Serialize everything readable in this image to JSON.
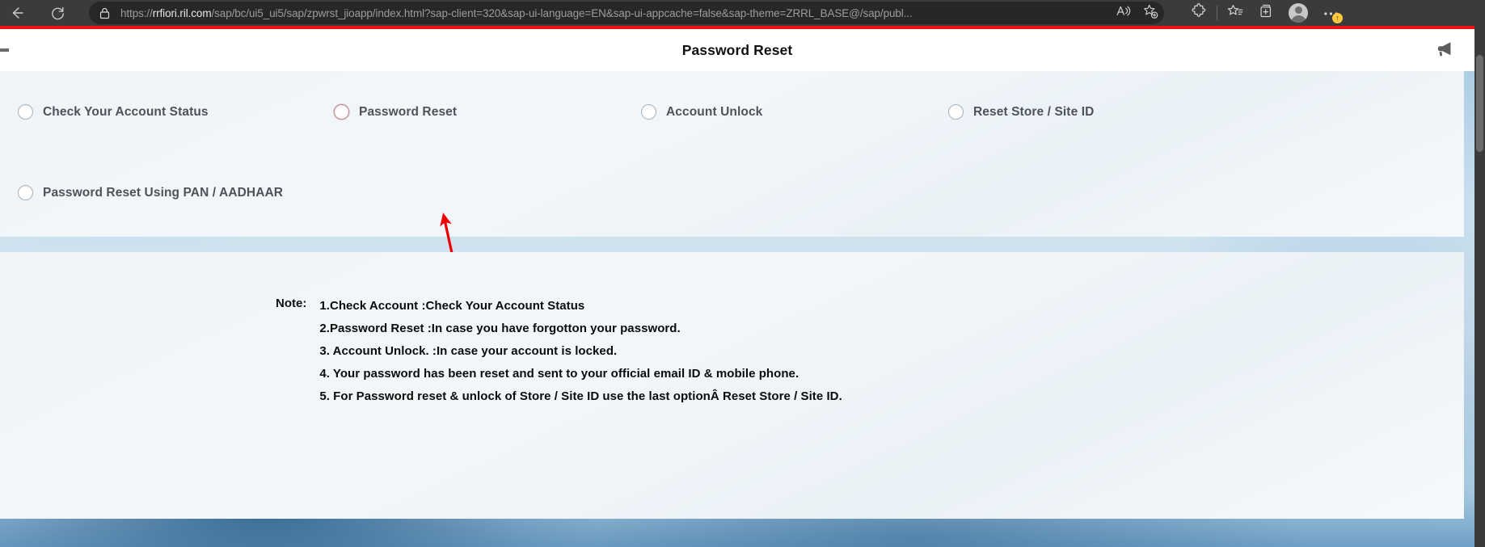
{
  "browser": {
    "url_host": "rrfiori.ril.com",
    "url_prefix": "https://",
    "url_path": "/sap/bc/ui5_ui5/sap/zpwrst_jioapp/index.html?sap-client=320&sap-ui-language=EN&sap-ui-appcache=false&sap-theme=ZRRL_BASE@/sap/publ...",
    "icons": {
      "back": "back-arrow-icon",
      "reload": "reload-icon",
      "lock": "lock-icon",
      "read_aloud": "read-aloud-icon",
      "add_favorite": "add-favorite-star-icon",
      "extensions": "extensions-puzzle-icon",
      "favorites": "favorites-list-icon",
      "collections": "collections-icon",
      "profile": "profile-avatar-icon",
      "settings": "settings-more-icon"
    },
    "update_badge": "↑"
  },
  "app": {
    "title": "Password Reset",
    "announcement_icon": "megaphone-icon",
    "accent_color": "#ee1111",
    "label_color": "#4d5358"
  },
  "options": [
    {
      "label": "Check Your Account Status",
      "state": "unselected",
      "highlight": false
    },
    {
      "label": "Password Reset",
      "state": "unselected",
      "highlight": true
    },
    {
      "label": "Account Unlock",
      "state": "unselected",
      "highlight": false
    },
    {
      "label": "Reset Store / Site ID",
      "state": "unselected",
      "highlight": false
    },
    {
      "label": "Password Reset Using PAN / AADHAAR",
      "state": "unselected",
      "highlight": false
    }
  ],
  "annotation": {
    "type": "arrow",
    "color": "#ef0000",
    "points_to": "Password Reset"
  },
  "note": {
    "label": "Note:",
    "lines": [
      "1.Check Account :Check Your Account Status",
      "2.Password Reset :In case you have forgotton your password.",
      "3. Account Unlock. :In case your account is locked.",
      "4. Your password has been reset and sent to your official email ID & mobile phone.",
      "5. For Password reset & unlock of Store / Site ID use the last optionÂ Reset Store / Site ID."
    ]
  }
}
